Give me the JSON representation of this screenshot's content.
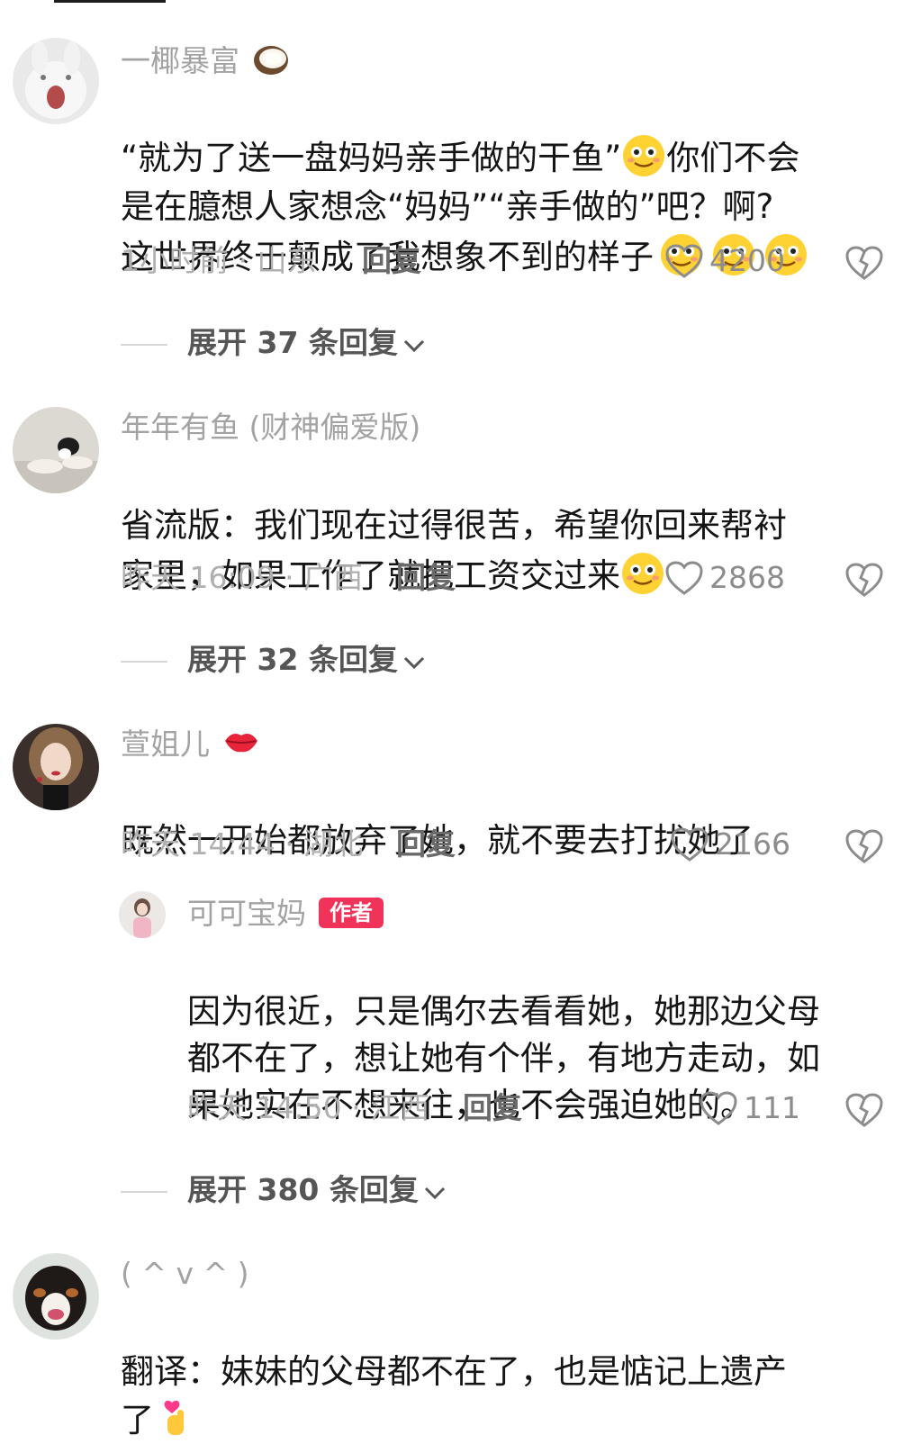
{
  "comments": [
    {
      "username": "一椰暴富",
      "name_emoji": "coconut-icon",
      "line1": "“就为了送一盘妈妈亲手做的干鱼”",
      "line1b": "你们不会",
      "line2": "是在臆想人家想念“妈妈”“亲手做的”吧？啊?",
      "line3": "这世界终于颠成了我想象不到的样子",
      "meta": "1小时前 · 山东",
      "reply_label": "回复",
      "likes": "4200",
      "expand": "展开 37 条回复"
    },
    {
      "username": "年年有鱼 (财神偏爱版)",
      "line1": "省流版：我们现在过得很苦，希望你回来帮衬",
      "line2": "家里，如果工作了就把工资交过来",
      "meta": "昨天 16:09 · 广西",
      "reply_label": "回复",
      "likes": "2868",
      "expand": "展开 32 条回复"
    },
    {
      "username": "萱姐儿",
      "name_emoji": "lips-icon",
      "line1": "既然一开始都放弃了她，就不要去打扰她了",
      "meta": "昨天 14:44 · 湖北",
      "reply_label": "回复",
      "likes": "2166",
      "expand": "展开 380 条回复"
    },
    {
      "username": "( ^ v ^ )",
      "line1": "翻译：妹妹的父母都不在了，也是惦记上遗产",
      "line2": "了"
    }
  ],
  "reply": {
    "username": "可可宝妈",
    "badge": "作者",
    "line1": "因为很近，只是偶尔去看看她，她那边父母",
    "line2": "都不在了，想让她有个伴，有地方走动，如",
    "line3": "果她实在不想来往，也不会强迫她的。",
    "meta": "昨天 14:50 · 江西",
    "reply_label": "回复",
    "likes": "111"
  },
  "colors": {
    "author_badge": "#f1335a",
    "meta_gray": "#b0b0b0"
  }
}
